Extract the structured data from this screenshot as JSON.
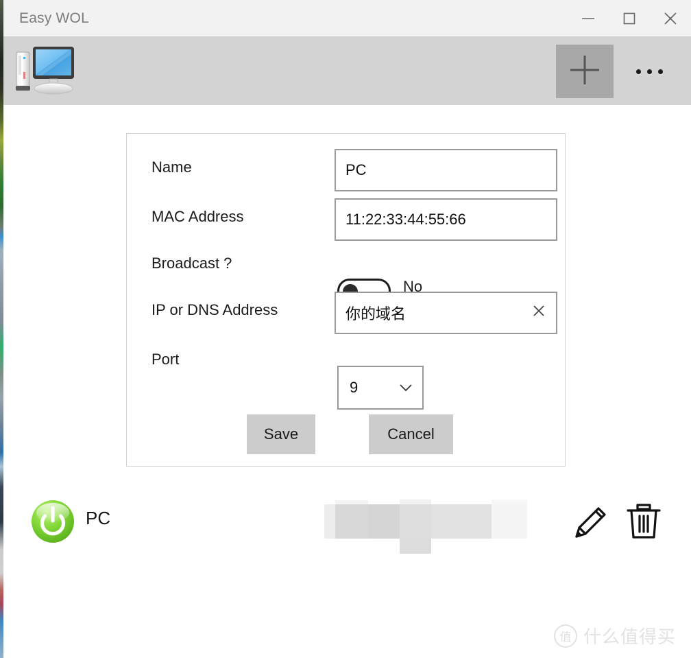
{
  "window": {
    "title": "Easy WOL",
    "caption_buttons": [
      {
        "name": "minimize",
        "glyph": "minimize-icon"
      },
      {
        "name": "maximize",
        "glyph": "maximize-icon"
      },
      {
        "name": "close",
        "glyph": "close-icon"
      }
    ]
  },
  "toolbar": {
    "app_icon": "desktop-computer-icon",
    "add_label": "+",
    "add_icon": "plus-icon",
    "more_icon": "ellipsis-icon"
  },
  "edit_panel": {
    "fields": [
      {
        "label": "Name",
        "value": "PC",
        "type": "text"
      },
      {
        "label": "MAC Address",
        "value": "11:22:33:44:55:66",
        "type": "text"
      },
      {
        "label": "Broadcast ?",
        "value": "No",
        "type": "toggle",
        "checked": false
      },
      {
        "label": "IP or DNS Address",
        "value": "你的域名",
        "type": "text",
        "clear_icon": "close-icon"
      },
      {
        "label": "Port",
        "value": "9",
        "type": "select",
        "chevron": "chevron-down-icon"
      }
    ],
    "save_label": "Save",
    "cancel_label": "Cancel"
  },
  "device_list": {
    "rows": [
      {
        "power_icon": "power-button-icon",
        "name": "PC",
        "details_redacted": true,
        "edit_icon": "pencil-icon",
        "delete_icon": "trash-icon"
      }
    ]
  },
  "watermark": {
    "badge": "值",
    "text": "什么值得买"
  },
  "colors": {
    "titlebar_bg": "#f2f2f2",
    "toolbar_bg": "#d3d3d3",
    "accent_button": "#a8a8a8",
    "field_border": "#9a9a9a",
    "panel_border": "#d2d2d2",
    "action_button_bg": "#cccccc",
    "power_on_green": "#66cc22"
  }
}
